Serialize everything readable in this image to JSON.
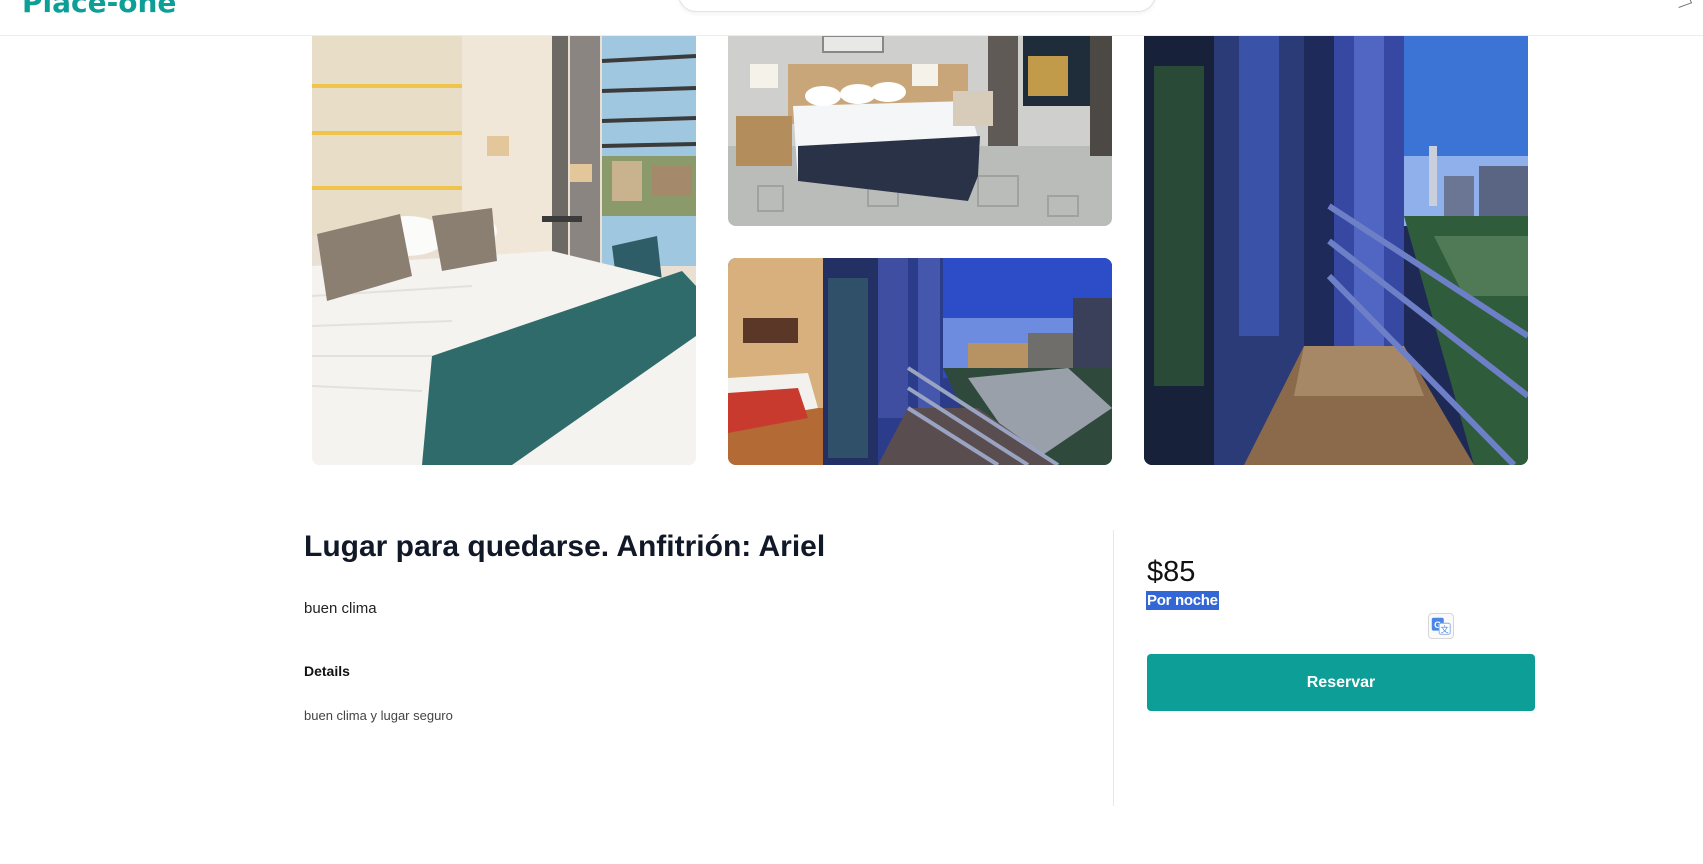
{
  "header": {
    "logo_text": "Place-one",
    "search_pill_text": "· · ·"
  },
  "gallery": {
    "images": [
      {
        "name": "main-bedroom-photo",
        "alt": "hotel room with bed and balcony"
      },
      {
        "name": "room-photo",
        "alt": "hotel room with bed"
      },
      {
        "name": "balcony-photo",
        "alt": "room with balcony at night"
      },
      {
        "name": "terrace-photo",
        "alt": "balcony view over city"
      }
    ]
  },
  "listing": {
    "title": "Lugar para quedarse. Anfitrión: Ariel",
    "summary": "buen clima",
    "details_heading": "Details",
    "details_text": "buen clima y lugar seguro"
  },
  "booking": {
    "price": "$85",
    "per_night": "Por noche",
    "reserve_label": "Reservar"
  },
  "colors": {
    "brand": "#0d9e97",
    "selection_highlight": "#3367d6"
  },
  "icons": [
    "translate-icon",
    "search-icon",
    "chevron-down-icon"
  ]
}
